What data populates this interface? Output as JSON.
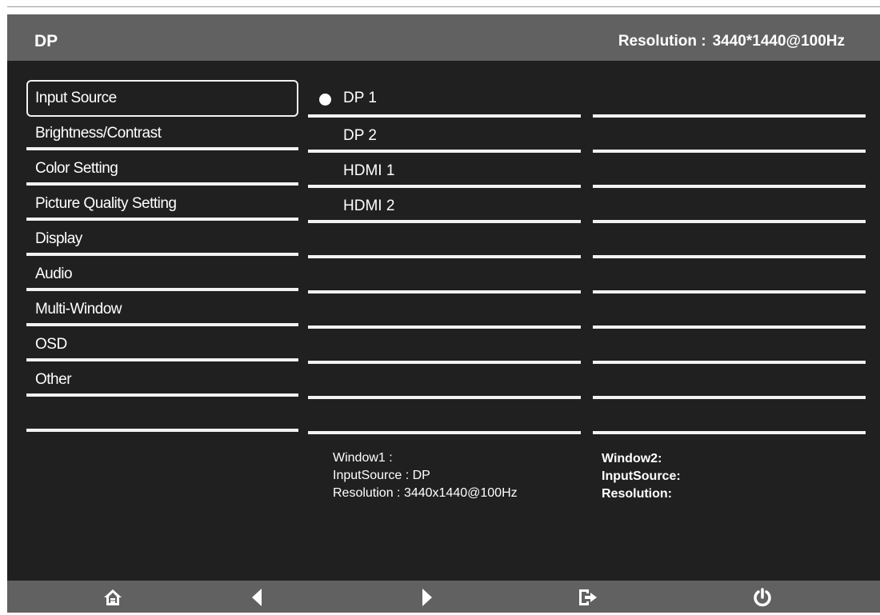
{
  "header": {
    "input_name": "DP",
    "resolution_label": "Resolution :",
    "resolution_value": "3440*1440@100Hz"
  },
  "menu": {
    "items": [
      {
        "label": "Input Source",
        "selected": true
      },
      {
        "label": "Brightness/Contrast"
      },
      {
        "label": "Color Setting"
      },
      {
        "label": "Picture Quality Setting"
      },
      {
        "label": "Display"
      },
      {
        "label": "Audio"
      },
      {
        "label": "Multi-Window"
      },
      {
        "label": "OSD"
      },
      {
        "label": "Other"
      },
      {
        "label": ""
      }
    ]
  },
  "sources": {
    "items": [
      {
        "label": "DP 1",
        "active": true
      },
      {
        "label": "DP 2"
      },
      {
        "label": "HDMI 1"
      },
      {
        "label": "HDMI 2"
      },
      {
        "label": ""
      },
      {
        "label": ""
      },
      {
        "label": ""
      },
      {
        "label": ""
      },
      {
        "label": ""
      },
      {
        "label": ""
      }
    ]
  },
  "window1": {
    "title": "Window1 :",
    "input_source": "InputSource : DP",
    "resolution": "Resolution : 3440x1440@100Hz"
  },
  "window2": {
    "title": "Window2:",
    "input_source": "InputSource:",
    "resolution": "Resolution:"
  },
  "footer": {
    "buttons": [
      {
        "icon": "home-icon"
      },
      {
        "icon": "left-arrow-icon"
      },
      {
        "icon": "right-arrow-icon"
      },
      {
        "icon": "exit-icon"
      },
      {
        "icon": "power-icon"
      }
    ]
  },
  "colors": {
    "bar_bg": "#616161",
    "panel_bg": "#202020",
    "text": "#ffffff"
  }
}
